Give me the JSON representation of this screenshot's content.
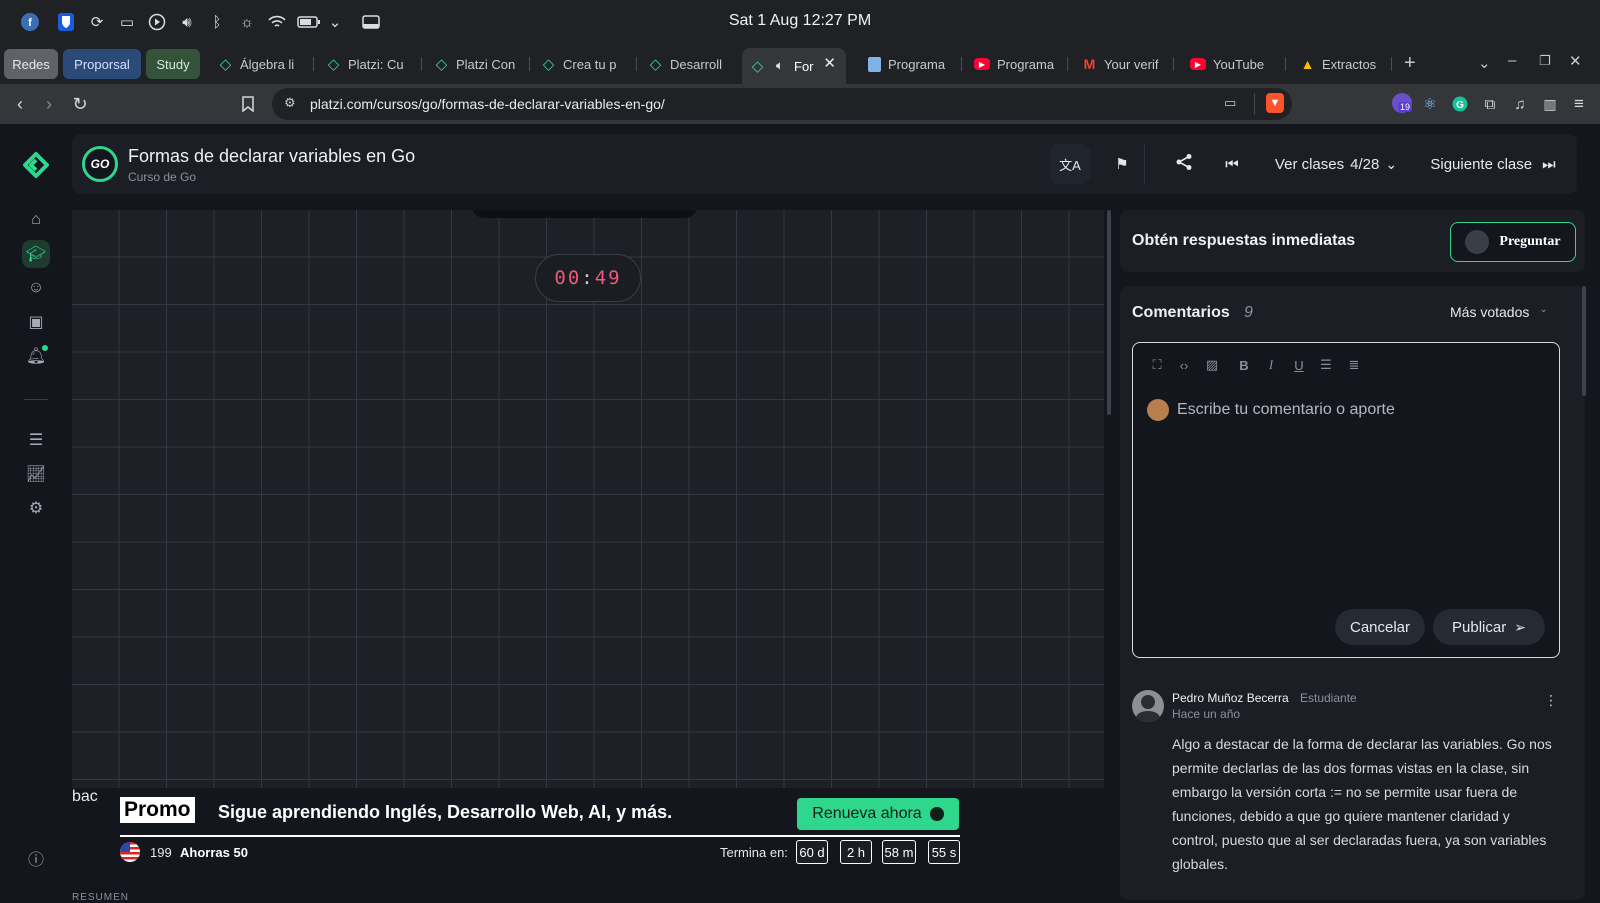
{
  "os": {
    "clock": "Sat 1 Aug 12:27 PM",
    "icons": [
      "fedora-icon",
      "bitwarden-icon",
      "update-icon",
      "clipboard-icon",
      "media-play-icon",
      "volume-icon",
      "bluetooth-icon",
      "brightness-icon",
      "wifi-icon",
      "battery-icon",
      "chevron-down-icon",
      "window-icon"
    ]
  },
  "tabs": {
    "groups": [
      {
        "label": "Redes",
        "color": "#5f6368"
      },
      {
        "label": "Proporsal",
        "color": "#2b4a78"
      },
      {
        "label": "Study",
        "color": "#35523b"
      }
    ],
    "items": [
      {
        "label": "Álgebra li",
        "icon": "platzi"
      },
      {
        "label": "Platzi: Cu",
        "icon": "platzi"
      },
      {
        "label": "Platzi Con",
        "icon": "platzi"
      },
      {
        "label": "Crea tu p",
        "icon": "platzi"
      },
      {
        "label": "Desarroll",
        "icon": "platzi"
      },
      {
        "label": "For",
        "icon": "platzi"
      },
      {
        "label": "Programa",
        "icon": "doc"
      },
      {
        "label": "Programa",
        "icon": "youtube"
      },
      {
        "label": "Your verif",
        "icon": "gmail"
      },
      {
        "label": "YouTube",
        "icon": "youtube"
      },
      {
        "label": "Extractos",
        "icon": "drive"
      }
    ],
    "new_tab": "+"
  },
  "browser": {
    "url": "platzi.com/cursos/go/formas-de-declarar-variables-en-go/",
    "extensions_badge": "19"
  },
  "header": {
    "logo_text": "GO",
    "class_title": "Formas de declarar variables en Go",
    "course_name": "Curso de Go",
    "ver_clases": "Ver clases",
    "progress": "4/28",
    "next_class": "Siguiente clase"
  },
  "video": {
    "timer_minutes": "00",
    "timer_sep": ":",
    "timer_seconds": "49"
  },
  "promo": {
    "broken_img_alt": "bac",
    "label": "Promo",
    "text": "Sigue aprendiendo Inglés, Desarrollo Web, AI, y más.",
    "cta": "Renueva ahora",
    "price": "199",
    "savings": "Ahorras 50",
    "ends_label": "Termina en:",
    "countdown": [
      "60 d",
      "2 h",
      "58 m",
      "55 s"
    ]
  },
  "resumen_label": "RESUMEN",
  "ask": {
    "title": "Obtén respuestas inmediatas",
    "button": "Preguntar"
  },
  "comments": {
    "title": "Comentarios",
    "count": "9",
    "sort": "Más votados",
    "placeholder": "Escribe tu comentario o aporte",
    "cancel": "Cancelar",
    "publish": "Publicar",
    "list": [
      {
        "author": "Pedro Muñoz Becerra",
        "role": "Estudiante",
        "time": "Hace un año",
        "lines": [
          "Algo a destacar de la forma de declarar las variables. Go nos",
          "permite declarlas de las dos formas vistas en la clase, sin",
          "embargo la versión corta := no se permite usar fuera de",
          "funciones, debido a que go quiere mantener claridad y",
          "control, puesto que al ser declaradas fuera, ya son variables",
          "globales."
        ]
      }
    ]
  },
  "colors": {
    "accent": "#2ed78b",
    "timer": "#f0577a",
    "background": "#13161c",
    "card": "#1b1e25"
  }
}
